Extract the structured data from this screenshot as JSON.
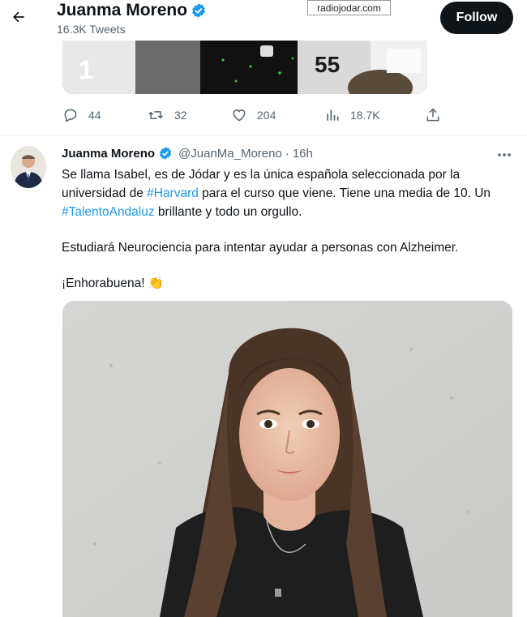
{
  "header": {
    "name": "Juanma Moreno",
    "tweet_count": "16.3K Tweets",
    "follow_label": "Follow",
    "watermark": "radiojodar.com"
  },
  "prev_tweet": {
    "jersey_number_left": "1",
    "jersey_number_right": "55",
    "actions": {
      "replies": "44",
      "retweets": "32",
      "likes": "204",
      "views": "18.7K"
    }
  },
  "tweet": {
    "author_name": "Juanma Moreno",
    "author_handle": "@JuanMa_Moreno",
    "separator": "·",
    "time": "16h",
    "p1_a": "Se llama Isabel, es de Jódar y es la única española seleccionada por la universidad de ",
    "hashtag1": "#Harvard",
    "p1_b": " para el curso que viene. Tiene una media de 10. Un ",
    "hashtag2": "#TalentoAndaluz",
    "p1_c": " brillante y todo un orgullo.",
    "p2": "Estudiará Neurociencia para intentar ayudar a personas con Alzheimer.",
    "p3": "¡Enhorabuena! 👏"
  },
  "colors": {
    "accent": "#1d9bf0",
    "text_primary": "#0f1419",
    "text_secondary": "#536471",
    "follow_bg": "#0f1419"
  }
}
